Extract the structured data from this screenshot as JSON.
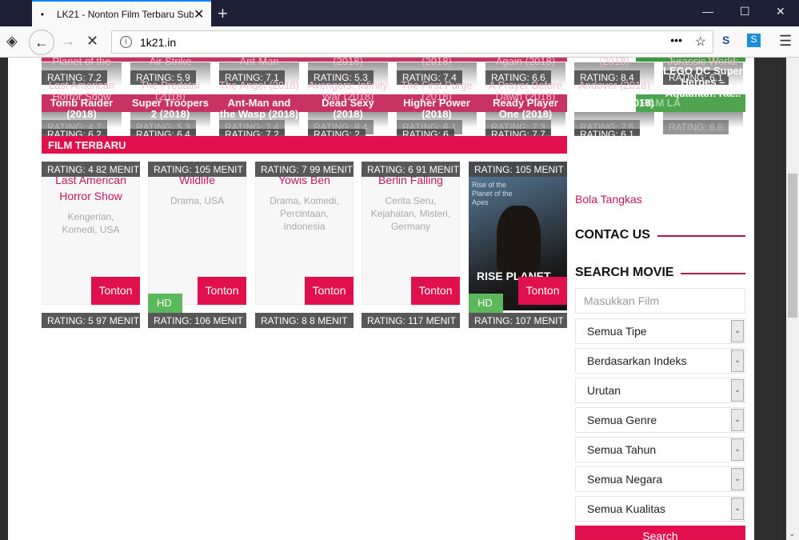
{
  "browser": {
    "tab_title": "LK21 - Nonton Film Terbaru Sub Indo",
    "url": "1k21.in",
    "new_tab": "+",
    "close": "✕"
  },
  "top_cards": [
    {
      "top_title": "Planet of the Apes",
      "rating_a": "RATING: 7.2",
      "back_title": "Last American Horror Show",
      "front_title": "Tomb Raider (2018)",
      "rating_b": "RATING: 4.7",
      "rating_c": "RATING: 6.2"
    },
    {
      "top_title": "Air Strike",
      "rating_a": "RATING: 5.9",
      "back_title": "The Predator (2018)",
      "front_title": "Super Troopers 2 (2018)",
      "rating_b": "RATING: 5.3",
      "rating_c": "RATING: 6.4"
    },
    {
      "top_title": "Ant-Man",
      "rating_a": "RATING: 7.1",
      "back_title": "The Angel (2018)",
      "front_title": "Ant-Man and the Wasp (2018)",
      "rating_b": "RATING: 7.4",
      "rating_c": "RATING: 7.2"
    },
    {
      "top_title": "(2018)",
      "rating_a": "RATING: 5.3",
      "back_title": "Avengers: Infinity War (2018)",
      "front_title": "Dead Sexy (2018)",
      "rating_b": "RATING: 8.4",
      "rating_c": "RATING: 2"
    },
    {
      "top_title": "(2018)",
      "rating_a": "RATING: 7.4",
      "back_title": "The First Purge (2018)",
      "front_title": "Higher Power (2018)",
      "rating_b": "RATING: 6.1",
      "rating_c": "RATING: 6"
    },
    {
      "top_title": "Again (2018)",
      "rating_a": "RATING: 6.6",
      "back_title": "A Prayer Before Dawn (2018)",
      "front_title": "Ready Player One (2018)",
      "rating_b": "RATING: 7.3",
      "rating_c": "RATING: 7.7"
    },
    {
      "top_title": "(2018)",
      "rating_a": "RATING: 8.4",
      "back_title": "Andover (2018)",
      "front_title": "Rampage (2018)",
      "rating_b": "RATING: 7.5",
      "rating_c": "RATING: 6.1"
    },
    {
      "top_title": "Jurassic World: Fallen Kingdom (2018)",
      "rating_a": "RATING: 6.1",
      "back_title": "",
      "front_title": "LEGO DC Super Heroes – Aquaman: Ra...",
      "rating_b": "RATING: 6.6",
      "rating_c": ""
    }
  ],
  "film_lama_label": "FILM LA",
  "film_terbaru": {
    "heading": "FILM TERBARU",
    "cards": [
      {
        "title": "Last American Horror Show",
        "genres": "Kengerian, Komedi, USA",
        "badge": "RATING: 4 82 MENIT",
        "button": "Tonton",
        "hd": ""
      },
      {
        "title": "Wildlife",
        "genres": "Drama, USA",
        "badge": "RATING: 105 MENIT",
        "button": "Tonton",
        "hd": "HD"
      },
      {
        "title": "Yowis Ben",
        "genres": "Drama, Komedi, Percintaan, Indonesia",
        "badge": "RATING: 7 99 MENIT",
        "button": "Tonton",
        "hd": ""
      },
      {
        "title": "Berlin Falling",
        "genres": "Cerita Seru, Kejahatan, Misteri, Germany",
        "badge": "RATING: 6 91 MENIT",
        "button": "Tonton",
        "hd": ""
      },
      {
        "title": "Rise of the Planet of the Apes",
        "genres": "",
        "badge": "RATING: 105 MENIT",
        "button": "Tonton",
        "hd": "HD",
        "poster_text": "RISE PLANET"
      }
    ],
    "row2_badges": [
      "RATING: 5 97 MENIT",
      "RATING: 106 MENIT",
      "RATING: 8 8 MENIT",
      "RATING: 117 MENIT",
      "RATING: 107 MENIT"
    ]
  },
  "sidebar": {
    "link": "Bola Tangkas",
    "contact_heading": "CONTAC US",
    "search_heading": "SEARCH MOVIE",
    "search_placeholder": "Masukkan Film",
    "selects": [
      "Semua Tipe",
      "Berdasarkan Indeks",
      "Urutan",
      "Semua Genre",
      "Semua Tahun",
      "Semua Negara",
      "Semua Kualitas"
    ],
    "search_button": "Search"
  }
}
